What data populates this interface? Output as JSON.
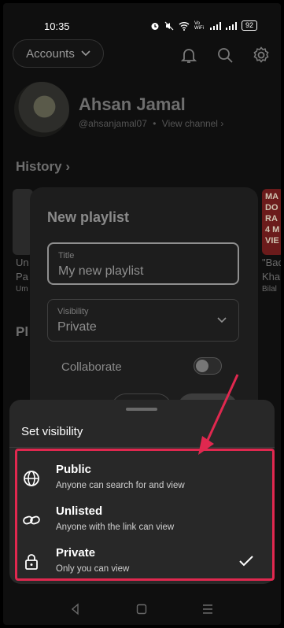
{
  "status": {
    "time": "10:35",
    "signal_text": "Vo WiFi",
    "battery": "92"
  },
  "header": {
    "accounts_label": "Accounts"
  },
  "profile": {
    "name": "Ahsan Jamal",
    "handle": "@ahsanjamal07",
    "separator": "•",
    "view_channel": "View channel"
  },
  "sections": {
    "history": "History",
    "playlists": "Pl"
  },
  "background": {
    "left_lines": [
      "Un",
      "Pa",
      "Um"
    ],
    "right_lines": [
      "\"Bac",
      "Kha",
      "Bilal"
    ],
    "right_thumb_lines": [
      "MA",
      "DO",
      "RA",
      "4 M",
      "VIE"
    ]
  },
  "dialog": {
    "title": "New playlist",
    "title_field": {
      "label": "Title",
      "value": "My new playlist"
    },
    "visibility_field": {
      "label": "Visibility",
      "value": "Private"
    },
    "collaborate_label": "Collaborate"
  },
  "sheet": {
    "title": "Set visibility",
    "options": [
      {
        "title": "Public",
        "subtitle": "Anyone can search for and view",
        "icon": "globe-icon"
      },
      {
        "title": "Unlisted",
        "subtitle": "Anyone with the link can view",
        "icon": "link-icon"
      },
      {
        "title": "Private",
        "subtitle": "Only you can view",
        "icon": "lock-icon",
        "selected": true
      }
    ]
  },
  "annotation": {
    "color": "#e0284f"
  }
}
